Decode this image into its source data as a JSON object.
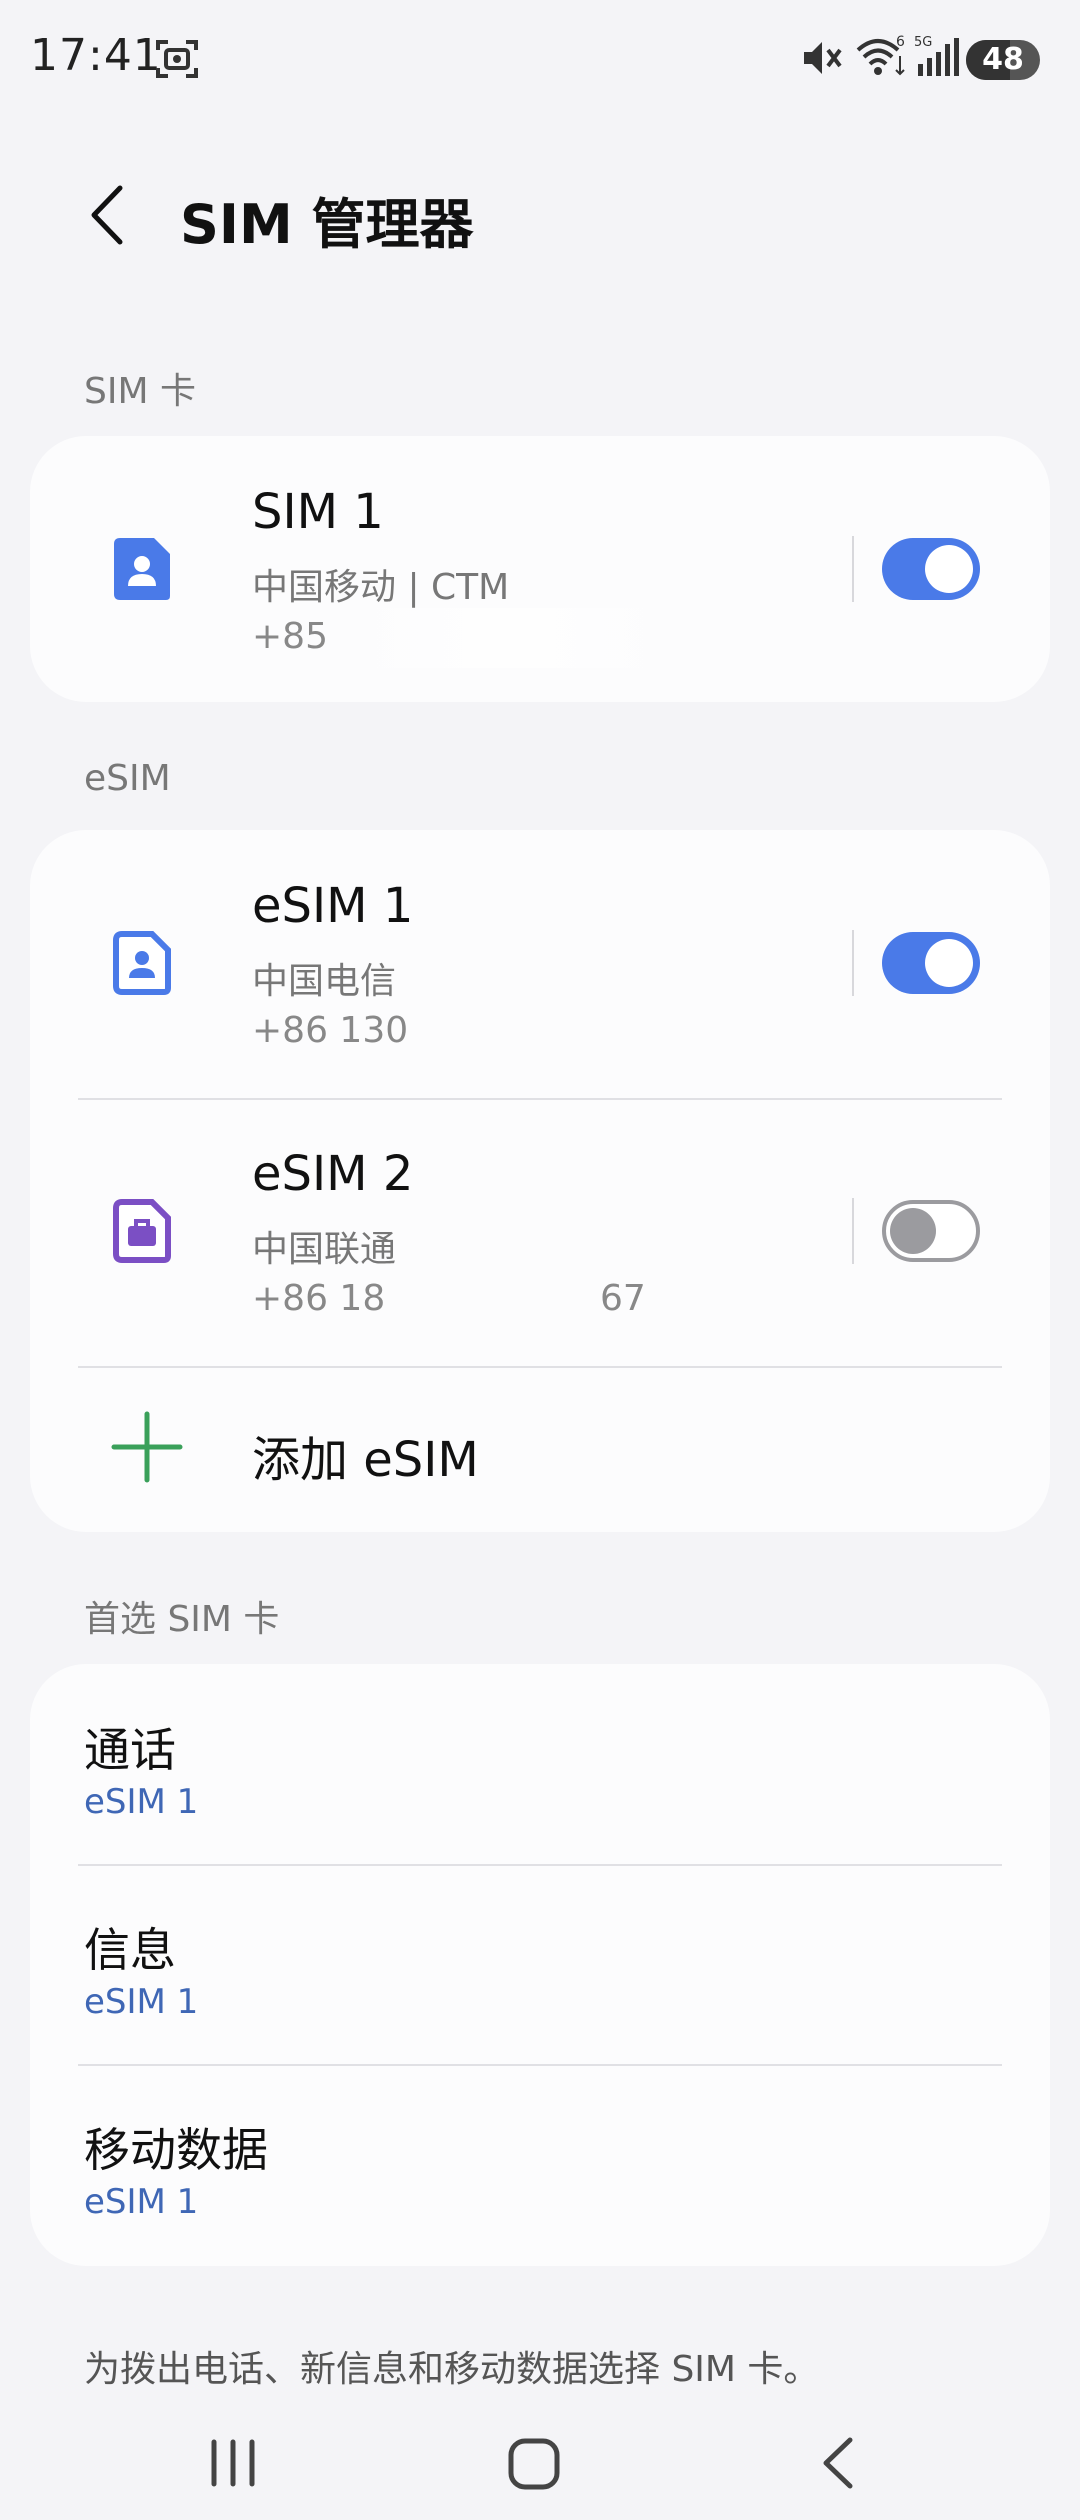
{
  "status_bar": {
    "time": "17:41",
    "battery": "48",
    "icons": [
      "screenshot-icon",
      "mute-icon",
      "wifi-icon",
      "signal-icon"
    ],
    "wifi_label": "6",
    "signal_label": "5G"
  },
  "header": {
    "title": "SIM 管理器",
    "back_icon": "chevron-left-icon"
  },
  "sections": {
    "sim_label": "SIM 卡",
    "esim_label": "eSIM",
    "preferred_label": "首选 SIM 卡"
  },
  "sim_cards": [
    {
      "name": "SIM 1",
      "carrier": "中国移动 | CTM",
      "number": "+853",
      "enabled": true,
      "icon": "sim-card-icon"
    }
  ],
  "esims": [
    {
      "name": "eSIM 1",
      "carrier": "中国电信",
      "number": "+86 130",
      "enabled": true,
      "icon": "sim-card-icon"
    },
    {
      "name": "eSIM 2",
      "carrier": "中国联通",
      "number": "+86 18",
      "number_tail": "67",
      "enabled": false,
      "icon": "work-sim-icon"
    }
  ],
  "add_esim": {
    "label": "添加 eSIM",
    "icon": "plus-icon"
  },
  "preferred": [
    {
      "title": "通话",
      "value": "eSIM 1"
    },
    {
      "title": "信息",
      "value": "eSIM 1"
    },
    {
      "title": "移动数据",
      "value": "eSIM 1"
    }
  ],
  "footnote": "为拨出电话、新信息和移动数据选择 SIM 卡。",
  "nav": {
    "icons": [
      "recents-icon",
      "home-icon",
      "back-icon"
    ]
  },
  "colors": {
    "accent": "#4a7ae8",
    "sim_icon_blue": "#4a7ae8",
    "work_icon_purple": "#7b4fc4",
    "plus_green": "#3aa05a",
    "pref_value": "#3f67b5"
  }
}
